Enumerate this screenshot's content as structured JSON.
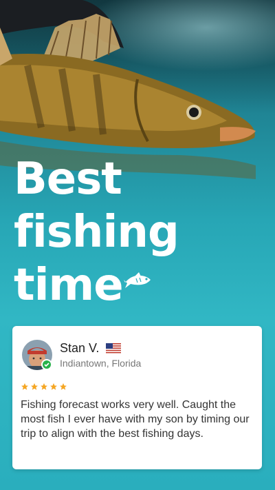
{
  "hero": {
    "title_lines": [
      "Best",
      "fishing",
      "time"
    ]
  },
  "review": {
    "name": "Stan V.",
    "location": "Indiantown, Florida",
    "rating": 5,
    "text": "Fishing forecast works very well. Caught the most fish I ever have with my son by timing our trip to align with the best fishing days."
  },
  "colors": {
    "accent_star": "#f5a623",
    "verified": "#27b24a",
    "water": "#2aaebd"
  },
  "icons": {
    "fish": "fish-icon",
    "flag": "us-flag-icon",
    "verified": "verified-check-icon",
    "star": "star-icon"
  }
}
